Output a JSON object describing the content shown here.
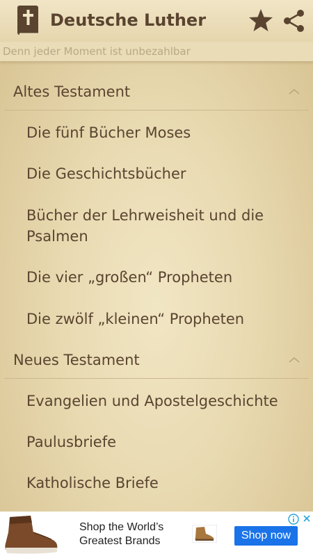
{
  "app": {
    "title": "Deutsche Luther",
    "subtitle": "Denn jeder Moment ist unbezahlbar",
    "app_icon": "bible-icon",
    "actions": [
      {
        "icon": "star-icon"
      },
      {
        "icon": "share-icon"
      }
    ]
  },
  "sections": [
    {
      "label": "Altes Testament",
      "expanded": true,
      "chevron": "chevron-up-icon",
      "items": [
        "Die fünf Bücher Moses",
        "Die Geschichtsbücher",
        "Bücher der Lehrweisheit und die Psalmen",
        "Die vier „großen“ Propheten",
        "Die zwölf „kleinen“ Propheten"
      ]
    },
    {
      "label": "Neues Testament",
      "expanded": true,
      "chevron": "chevron-up-icon",
      "items": [
        "Evangelien und Apostelgeschichte",
        "Paulusbriefe",
        "Katholische Briefe"
      ]
    }
  ],
  "ad": {
    "text": "Shop the World’s Greatest Brands",
    "cta": "Shop now",
    "image": "brown-boot-image",
    "info_icon": "info-icon",
    "close_icon": "close-icon"
  },
  "colors": {
    "text": "#5a4430",
    "background": "#ecdfb9",
    "cta": "#1a73e8"
  }
}
